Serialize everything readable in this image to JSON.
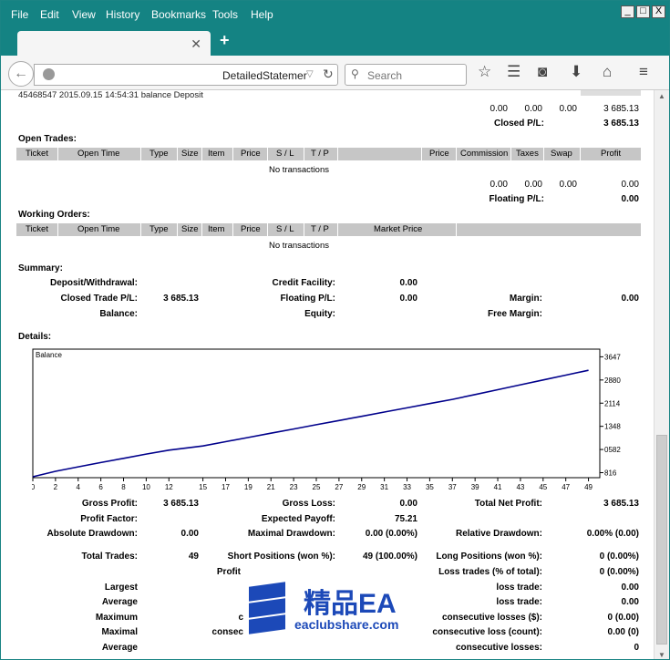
{
  "browser": {
    "menu": [
      "File",
      "Edit",
      "View",
      "History",
      "Bookmarks",
      "Tools",
      "Help"
    ],
    "url": "DetailedStatemer",
    "search_placeholder": "Search",
    "window_controls": [
      "_",
      "□",
      "X"
    ]
  },
  "top_row": {
    "text": "45468547  2015.09.15 14:54:31   balance  Deposit"
  },
  "closed": {
    "values": [
      "0.00",
      "0.00",
      "0.00",
      "3 685.13"
    ],
    "label": "Closed P/L:",
    "total": "3 685.13"
  },
  "open_trades": {
    "title": "Open Trades:",
    "headers": [
      "Ticket",
      "Open Time",
      "Type",
      "Size",
      "Item",
      "Price",
      "S / L",
      "T / P",
      "Price",
      "Commission",
      "Taxes",
      "Swap",
      "Profit"
    ],
    "empty": "No transactions",
    "values": [
      "0.00",
      "0.00",
      "0.00",
      "0.00"
    ],
    "label": "Floating P/L:",
    "total": "0.00"
  },
  "working_orders": {
    "title": "Working Orders:",
    "headers": [
      "Ticket",
      "Open Time",
      "Type",
      "Size",
      "Item",
      "Price",
      "S / L",
      "T / P",
      "Market Price"
    ],
    "empty": "No transactions"
  },
  "summary": {
    "title": "Summary:",
    "deposit_label": "Deposit/Withdrawal:",
    "credit_label": "Credit Facility:",
    "credit_value": "0.00",
    "closed_label": "Closed Trade P/L:",
    "closed_value": "3 685.13",
    "floating_label": "Floating P/L:",
    "floating_value": "0.00",
    "margin_label": "Margin:",
    "margin_value": "0.00",
    "balance_label": "Balance:",
    "equity_label": "Equity:",
    "free_margin_label": "Free Margin:"
  },
  "details": {
    "title": "Details:",
    "gross_profit_label": "Gross Profit:",
    "gross_profit": "3 685.13",
    "gross_loss_label": "Gross Loss:",
    "gross_loss": "0.00",
    "net_profit_label": "Total Net Profit:",
    "net_profit": "3 685.13",
    "profit_factor_label": "Profit Factor:",
    "expected_payoff_label": "Expected Payoff:",
    "expected_payoff": "75.21",
    "abs_dd_label": "Absolute Drawdown:",
    "abs_dd": "0.00",
    "max_dd_label": "Maximal Drawdown:",
    "max_dd": "0.00 (0.00%)",
    "rel_dd_label": "Relative Drawdown:",
    "rel_dd": "0.00% (0.00)",
    "total_trades_label": "Total Trades:",
    "total_trades": "49",
    "short_label": "Short Positions (won %):",
    "short": "49 (100.00%)",
    "long_label": "Long Positions (won %):",
    "long": "0 (0.00%)",
    "profit_trades_label": "Profit",
    "loss_trades_label": "Loss trades (% of total):",
    "loss_trades": "0 (0.00%)",
    "largest_label": "Largest",
    "largest_loss_label": "loss trade:",
    "largest_loss": "0.00",
    "average_label": "Average",
    "average_loss_label": "loss trade:",
    "average_loss": "0.00",
    "maximum_label": "Maximum",
    "max_c_label": "c",
    "max_consec_label": "consecutive losses ($):",
    "max_consec": "0 (0.00)",
    "maximal_label": "Maximal",
    "maximal_c_label": "consec",
    "maximal_consec_label": "consecutive loss (count):",
    "maximal_consec": "0.00 (0)",
    "average2_label": "Average",
    "avg_consec_label": "consecutive losses:",
    "avg_consec": "0"
  },
  "watermark": {
    "title": "精品EA",
    "domain": "eaclubshare.com"
  },
  "chart_data": {
    "type": "line",
    "title": "Balance",
    "xlabel": "",
    "ylabel": "",
    "x_ticks": [
      0,
      2,
      4,
      6,
      8,
      10,
      12,
      15,
      17,
      19,
      21,
      23,
      25,
      27,
      29,
      31,
      33,
      35,
      37,
      39,
      41,
      43,
      45,
      47,
      49
    ],
    "x_tick_labels": [
      "0",
      "2",
      "4",
      "6",
      "8",
      "10",
      "12",
      "15",
      "17",
      "19",
      "21",
      "23",
      "25",
      "27",
      "29",
      "31",
      "33",
      "35",
      "37",
      "39",
      "41",
      "43",
      "45",
      "47",
      "49"
    ],
    "y_tick_labels": [
      "3647",
      "2880",
      "2114",
      "1348",
      "0582",
      "816"
    ],
    "y_ticks": [
      3647,
      2880,
      2114,
      1348,
      582,
      -184
    ],
    "xlim": [
      0,
      50
    ],
    "ylim": [
      -350,
      3900
    ],
    "series": [
      {
        "color": "#00008b",
        "x": [
          0,
          2,
          4,
          6,
          8,
          10,
          12,
          15,
          17,
          19,
          21,
          23,
          25,
          27,
          29,
          31,
          33,
          35,
          37,
          39,
          41,
          43,
          45,
          47,
          49
        ],
        "y": [
          -320,
          -140,
          10,
          150,
          290,
          430,
          560,
          700,
          840,
          980,
          1120,
          1260,
          1400,
          1540,
          1680,
          1820,
          1960,
          2100,
          2240,
          2400,
          2560,
          2720,
          2880,
          3040,
          3200
        ]
      }
    ],
    "grid": false,
    "legend": "none"
  }
}
